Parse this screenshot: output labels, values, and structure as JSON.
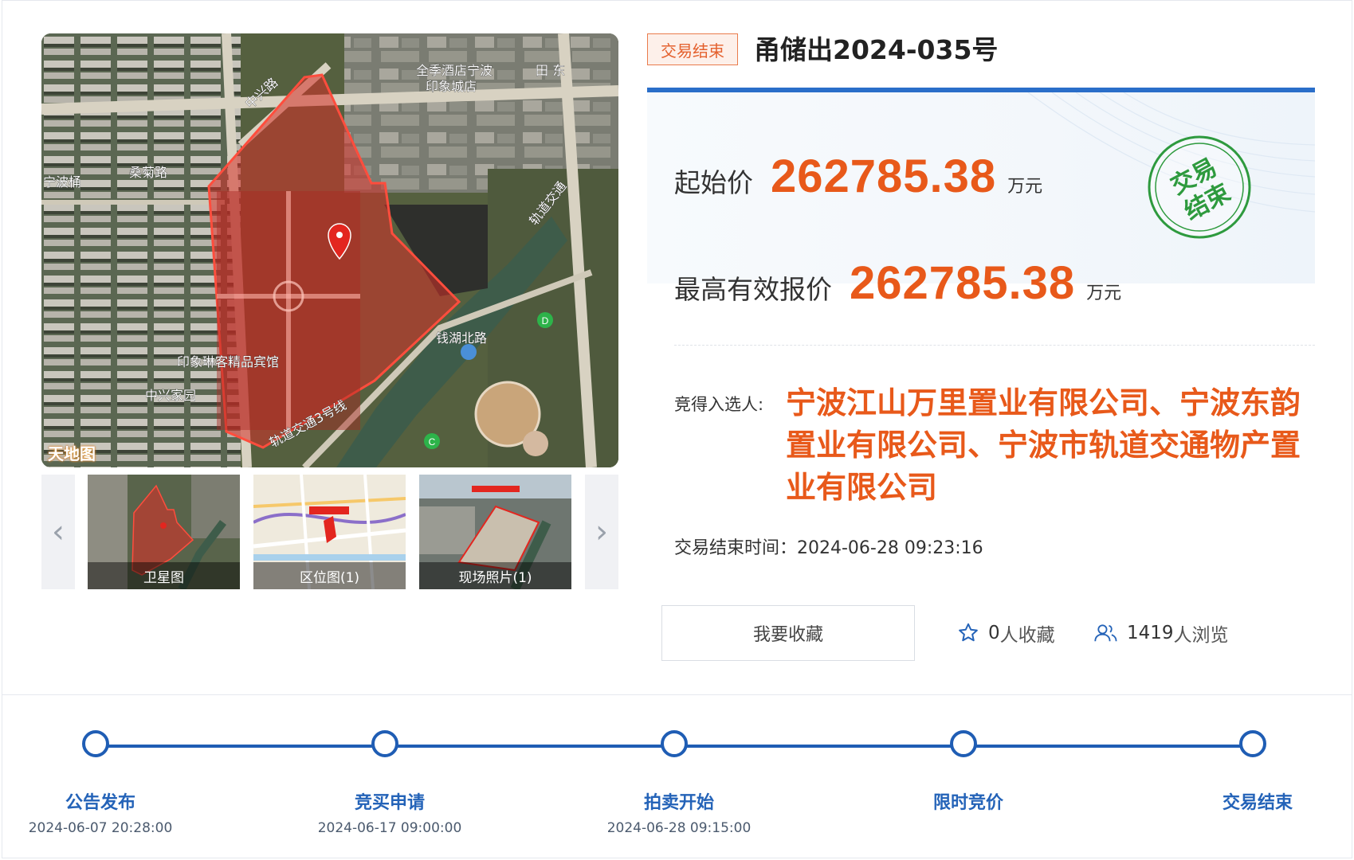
{
  "map": {
    "labels": {
      "road_zhongxing": "中兴路",
      "road_sangju": "桑菊路",
      "place_ningbo": "宁波桶",
      "hotel_quanji": "全季酒店宁波",
      "hotel_quanji_2": "印象城店",
      "place_tian": "田 东",
      "rail_top": "轨道交通",
      "road_qianhu": "钱湖北路",
      "hotel_yinxiang": "印象琳客精品宾馆",
      "place_zhongxing_home": "中兴家园",
      "rail_bottom": "轨道交通3号线",
      "station_d": "D",
      "station_c": "C",
      "vendor": "天地图"
    },
    "thumbnails": [
      {
        "caption": "卫星图"
      },
      {
        "caption": "区位图(1)"
      },
      {
        "caption": "现场照片(1)"
      }
    ],
    "prev_icon": "chevron-left-icon",
    "next_icon": "chevron-right-icon"
  },
  "lot": {
    "status": "交易结束",
    "title": "甬储出2024-035号"
  },
  "price": {
    "start_label": "起始价",
    "start_value": "262785.38",
    "start_unit": "万元",
    "highest_label": "最高有效报价",
    "highest_value": "262785.38",
    "highest_unit": "万元",
    "stamp_line1": "交易",
    "stamp_line2": "结束"
  },
  "winner": {
    "label": "竞得入选人:",
    "value": "宁波江山万里置业有限公司、宁波东韵置业有限公司、宁波市轨道交通物产置业有限公司"
  },
  "end_time": "交易结束时间：2024-06-28 09:23:16",
  "actions": {
    "favorite_button": "我要收藏",
    "favorites_count": "0",
    "favorites_suffix": "人收藏",
    "views_count": "1419",
    "views_suffix": "人浏览"
  },
  "timeline": [
    {
      "title": "公告发布",
      "date": "2024-06-07 20:28:00"
    },
    {
      "title": "竞买申请",
      "date": "2024-06-17 09:00:00"
    },
    {
      "title": "拍卖开始",
      "date": "2024-06-28 09:15:00"
    },
    {
      "title": "限时竞价",
      "date": ""
    },
    {
      "title": "交易结束",
      "date": ""
    }
  ],
  "colors": {
    "accent_orange": "#e8591a",
    "brand_blue": "#1f5db4",
    "stamp_green": "#2e9a3e"
  }
}
